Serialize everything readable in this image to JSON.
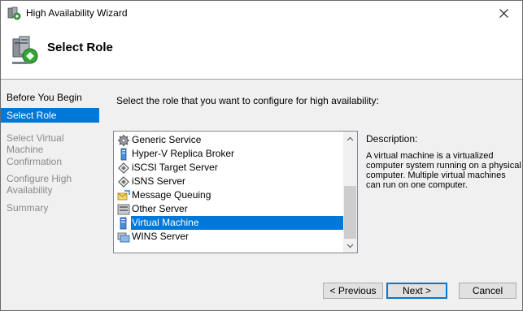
{
  "window": {
    "title": "High Availability Wizard",
    "icons": {
      "app": "cluster-wizard-icon",
      "close": "close-icon"
    }
  },
  "header": {
    "title": "Select Role",
    "icon": "servers-cluster-icon"
  },
  "nav": {
    "items": [
      {
        "label": "Before You Begin",
        "state": "normal"
      },
      {
        "label": "Select Role",
        "state": "selected"
      },
      {
        "label": "Select Virtual Machine",
        "state": "disabled"
      },
      {
        "label": "Confirmation",
        "state": "disabled"
      },
      {
        "label": "Configure High Availability",
        "state": "disabled"
      },
      {
        "label": "Summary",
        "state": "disabled"
      }
    ]
  },
  "content": {
    "instruction": "Select the role that you want to configure for high availability:",
    "roles": [
      {
        "label": "Generic Service",
        "icon": "gear-icon",
        "selected": false
      },
      {
        "label": "Hyper-V Replica Broker",
        "icon": "server-icon",
        "selected": false
      },
      {
        "label": "iSCSI Target Server",
        "icon": "iscsi-diamond-icon",
        "selected": false
      },
      {
        "label": "iSNS Server",
        "icon": "isns-diamond-icon",
        "selected": false
      },
      {
        "label": "Message Queuing",
        "icon": "message-queue-icon",
        "selected": false
      },
      {
        "label": "Other Server",
        "icon": "other-server-icon",
        "selected": false
      },
      {
        "label": "Virtual Machine",
        "icon": "virtual-machine-icon",
        "selected": true
      },
      {
        "label": "WINS Server",
        "icon": "wins-server-icon",
        "selected": false
      }
    ],
    "description_label": "Description:",
    "description_text": "A virtual machine is a virtualized computer system running on a physical computer. Multiple virtual machines can run on one computer."
  },
  "buttons": {
    "previous": "< Previous",
    "next": "Next >",
    "cancel": "Cancel"
  },
  "colors": {
    "selection": "#0078d7",
    "panel": "#f0f0f0",
    "disabled_text": "#8a8a8a"
  }
}
